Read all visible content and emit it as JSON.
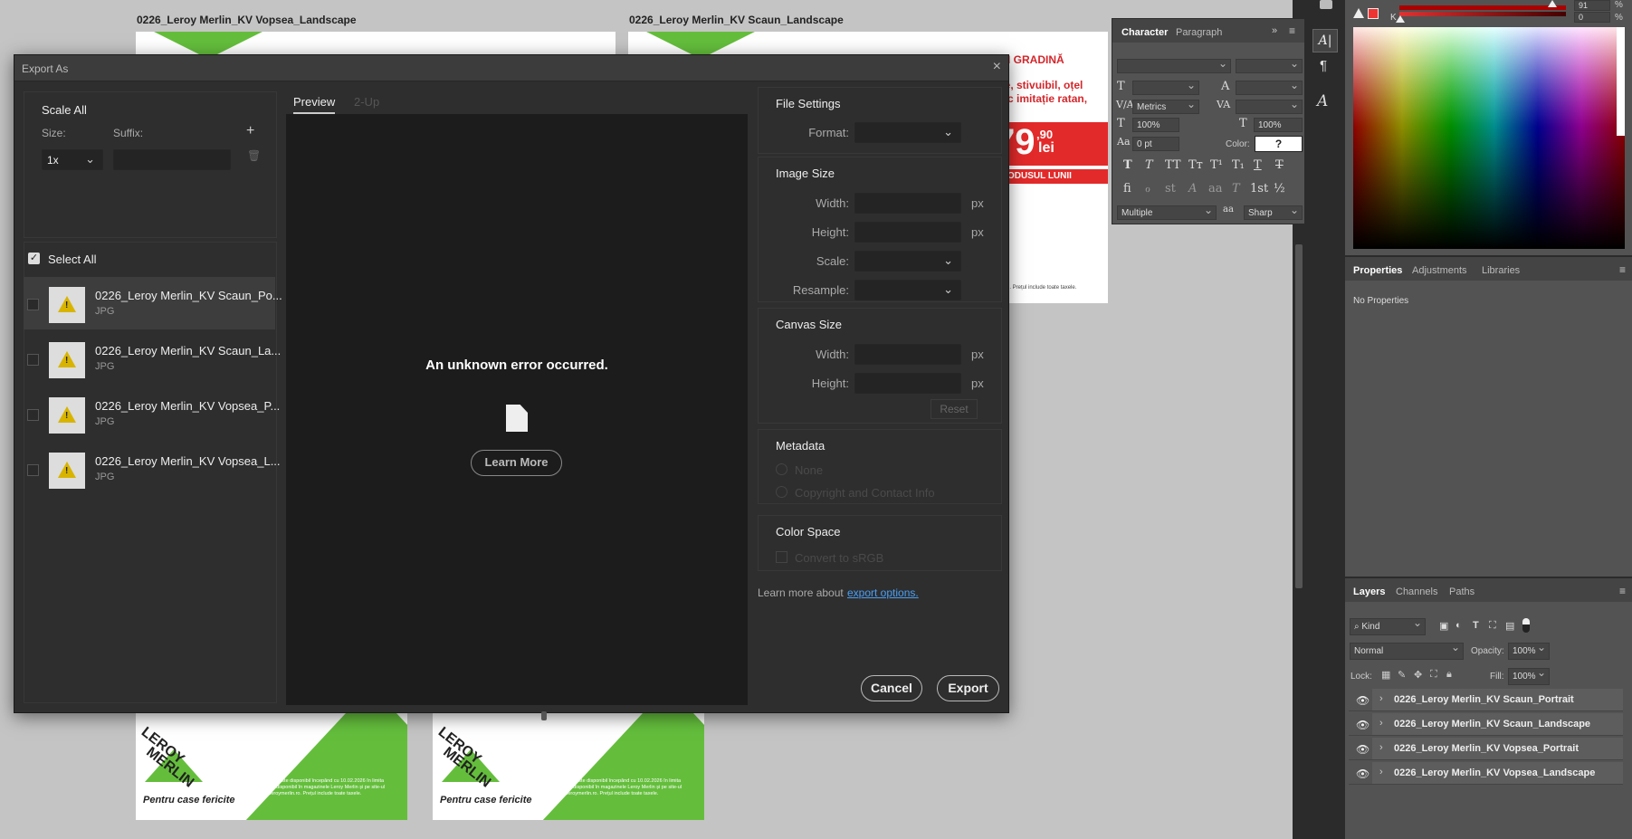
{
  "canvas": {
    "artboard_top_left_label": "0226_Leroy Merlin_KV Vopsea_Landscape",
    "artboard_top_right_label": "0226_Leroy Merlin_KV Scaun_Landscape",
    "ad_line1": "UN GRADINĂ",
    "ad_line2": "ate, stivuibil, oțel",
    "ad_line3": "stic imitație ratan,",
    "price_main": "79",
    "price_cents": ",90",
    "price_unit": "lei",
    "ad_banner": "ODUSUL LUNII",
    "ad_footnote": "i. Prețul include toate taxele.",
    "brand_line1": "LEROY",
    "brand_line2": "MERLIN",
    "brand_tagline": "Pentru case fericite",
    "legal_text": "Produsul este disponibil începând cu 10.02.2026 în limita stocului disponibil în magazinele Leroy Merlin și pe site-ul www.leroymerlin.ro. Prețul include toate taxele."
  },
  "dialog": {
    "title": "Export As",
    "scale_all_label": "Scale All",
    "size_label": "Size:",
    "suffix_label": "Suffix:",
    "size_value": "1x",
    "select_all_label": "Select All",
    "files": [
      {
        "name": "0226_Leroy Merlin_KV Scaun_Po...",
        "type": "JPG"
      },
      {
        "name": "0226_Leroy Merlin_KV Scaun_La...",
        "type": "JPG"
      },
      {
        "name": "0226_Leroy Merlin_KV Vopsea_P...",
        "type": "JPG"
      },
      {
        "name": "0226_Leroy Merlin_KV Vopsea_L...",
        "type": "JPG"
      }
    ],
    "tab_preview": "Preview",
    "tab_2up": "2-Up",
    "error_message": "An unknown error occurred.",
    "learn_more_button": "Learn More",
    "file_settings": {
      "heading": "File Settings",
      "format_label": "Format:"
    },
    "image_size": {
      "heading": "Image Size",
      "width_label": "Width:",
      "height_label": "Height:",
      "scale_label": "Scale:",
      "resample_label": "Resample:",
      "unit": "px"
    },
    "canvas_size": {
      "heading": "Canvas Size",
      "width_label": "Width:",
      "height_label": "Height:",
      "unit": "px",
      "reset_label": "Reset"
    },
    "metadata": {
      "heading": "Metadata",
      "option_none": "None",
      "option_copyright": "Copyright and Contact Info"
    },
    "color_space": {
      "heading": "Color Space",
      "convert_label": "Convert to sRGB"
    },
    "learn_more_text": "Learn more about",
    "export_options_link": "export options.",
    "cancel_button": "Cancel",
    "export_button": "Export"
  },
  "character_panel": {
    "tab_character": "Character",
    "tab_paragraph": "Paragraph",
    "kerning_value": "Metrics",
    "vertical_scale": "100%",
    "horizontal_scale": "100%",
    "baseline_shift": "0 pt",
    "color_label": "Color:",
    "color_value": "?",
    "language_value": "Multiple",
    "aa_label": "a",
    "antialias_value": "Sharp"
  },
  "color_panel": {
    "k_label": "K",
    "value_top": "91",
    "value_k": "0",
    "percent": "%"
  },
  "properties_panel": {
    "tab_properties": "Properties",
    "tab_adjustments": "Adjustments",
    "tab_libraries": "Libraries",
    "no_properties": "No Properties"
  },
  "layers_panel": {
    "tab_layers": "Layers",
    "tab_channels": "Channels",
    "tab_paths": "Paths",
    "kind_label": "Kind",
    "blend_mode": "Normal",
    "opacity_label": "Opacity:",
    "opacity_value": "100%",
    "lock_label": "Lock:",
    "fill_label": "Fill:",
    "fill_value": "100%",
    "layers": [
      "0226_Leroy Merlin_KV Scaun_Portrait",
      "0226_Leroy Merlin_KV Scaun_Landscape",
      "0226_Leroy Merlin_KV Vopsea_Portrait",
      "0226_Leroy Merlin_KV Vopsea_Landscape"
    ]
  },
  "colors": {
    "accent_blue": "#4a9ff5",
    "brand_green": "#64be3c",
    "ad_red": "#e32a2a",
    "warn_yellow": "#d8b400"
  }
}
